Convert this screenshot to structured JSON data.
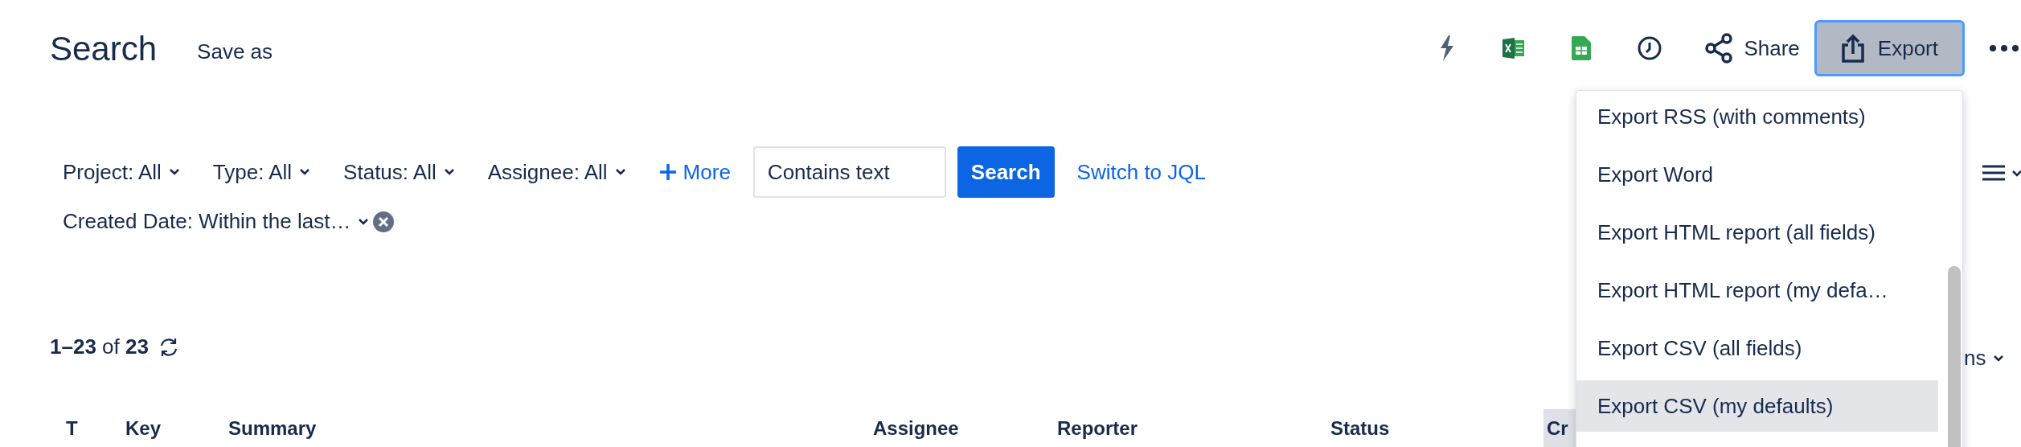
{
  "header": {
    "title": "Search",
    "save_as": "Save as",
    "share": "Share",
    "export": {
      "label": "Export",
      "expanded": true
    }
  },
  "filters": [
    {
      "label": "Project: All"
    },
    {
      "label": "Type: All"
    },
    {
      "label": "Status: All"
    },
    {
      "label": "Assignee: All"
    }
  ],
  "more": "More",
  "text_field": {
    "placeholder": "Contains text"
  },
  "search_button": "Search",
  "switch_link": "Switch to JQL",
  "active_filter": {
    "label": "Created Date: Within the last…"
  },
  "results": "**1–23** of **23**",
  "columns": [
    {
      "label": "T",
      "highlighted": false
    },
    {
      "label": "Key",
      "highlighted": false
    },
    {
      "label": "Summary",
      "highlighted": false
    },
    {
      "label": "Assignee",
      "highlighted": false
    },
    {
      "label": "Reporter",
      "highlighted": false
    },
    {
      "label": "Status",
      "highlighted": false
    },
    {
      "label": "Cr",
      "highlighted": true
    }
  ],
  "columns_button": "ns",
  "export_menu": [
    {
      "label": "Export RSS (with comments)",
      "selected": false
    },
    {
      "label": "Export Word",
      "selected": false
    },
    {
      "label": "Export HTML report (all fields)",
      "selected": false
    },
    {
      "label": "Export HTML report (my defa…",
      "selected": false
    },
    {
      "label": "Export CSV (all fields)",
      "selected": false
    },
    {
      "label": "Export CSV (my defaults)",
      "selected": true
    }
  ]
}
